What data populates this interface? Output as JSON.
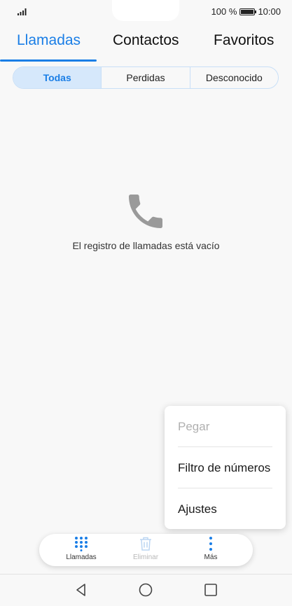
{
  "status_bar": {
    "battery_text": "100 %",
    "time": "10:00",
    "icons": [
      "signal-icon",
      "battery-icon"
    ]
  },
  "main_tabs": [
    {
      "label": "Llamadas",
      "active": true
    },
    {
      "label": "Contactos",
      "active": false
    },
    {
      "label": "Favoritos",
      "active": false
    }
  ],
  "filter_tabs": [
    {
      "label": "Todas",
      "active": true
    },
    {
      "label": "Perdidas",
      "active": false
    },
    {
      "label": "Desconocido",
      "active": false
    }
  ],
  "empty_state": {
    "icon": "phone-icon",
    "message": "El registro de llamadas está vacío"
  },
  "overflow_menu": {
    "items": [
      {
        "label": "Pegar",
        "enabled": false
      },
      {
        "label": "Filtro de números",
        "enabled": true
      },
      {
        "label": "Ajustes",
        "enabled": true
      }
    ]
  },
  "bottom_actions": [
    {
      "label": "Llamadas",
      "icon": "dialpad-icon",
      "enabled": true
    },
    {
      "label": "Eliminar",
      "icon": "trash-icon",
      "enabled": false
    },
    {
      "label": "Más",
      "icon": "more-vertical-icon",
      "enabled": true
    }
  ],
  "system_nav": [
    "back-icon",
    "home-icon",
    "recents-icon"
  ],
  "colors": {
    "accent": "#1a7ee6",
    "segment_active_bg": "#d6e8fb",
    "disabled_text": "#b0b0b0",
    "icon_gray": "#9a9a9a"
  }
}
